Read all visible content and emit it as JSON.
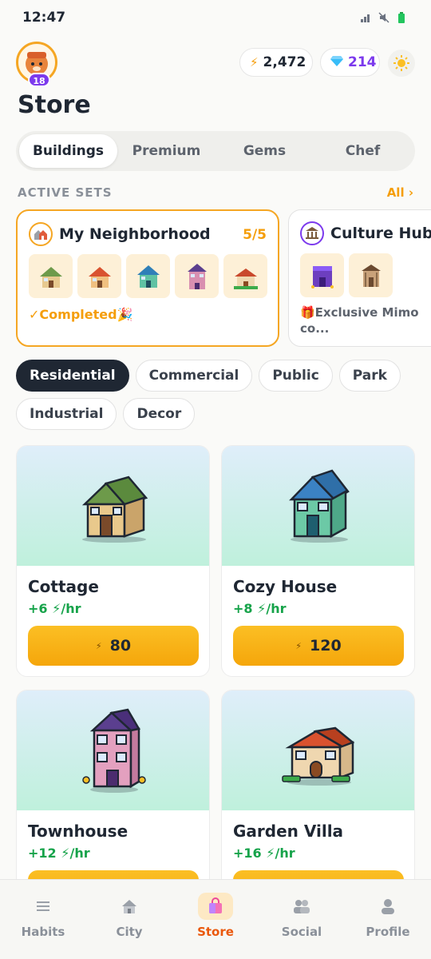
{
  "status": {
    "time": "12:47"
  },
  "header": {
    "level": "18",
    "energy": "2,472",
    "gems": "214"
  },
  "page": {
    "title": "Store"
  },
  "tabs": [
    {
      "label": "Buildings"
    },
    {
      "label": "Premium"
    },
    {
      "label": "Gems"
    },
    {
      "label": "Chef"
    }
  ],
  "active_sets": {
    "label": "ACTIVE SETS",
    "all_label": "All ›",
    "sets": [
      {
        "title": "My Neighborhood",
        "count": "5/5",
        "status": "✓Completed🎉"
      },
      {
        "title": "Culture Hub",
        "status": "🎁Exclusive Mimo co..."
      }
    ]
  },
  "categories": [
    "Residential",
    "Commercial",
    "Public",
    "Park",
    "Industrial",
    "Decor"
  ],
  "products": [
    {
      "name": "Cottage",
      "rate": "+6 ⚡/hr",
      "price": "80"
    },
    {
      "name": "Cozy House",
      "rate": "+8 ⚡/hr",
      "price": "120"
    },
    {
      "name": "Townhouse",
      "rate": "+12 ⚡/hr",
      "price": ""
    },
    {
      "name": "Garden Villa",
      "rate": "+16 ⚡/hr",
      "price": ""
    }
  ],
  "nav": [
    {
      "label": "Habits"
    },
    {
      "label": "City"
    },
    {
      "label": "Store"
    },
    {
      "label": "Social"
    },
    {
      "label": "Profile"
    }
  ],
  "colors": {
    "accent": "#f59e0b",
    "primary_dark": "#1f2733",
    "gem_purple": "#7c3aed",
    "rate_green": "#16a34a"
  }
}
